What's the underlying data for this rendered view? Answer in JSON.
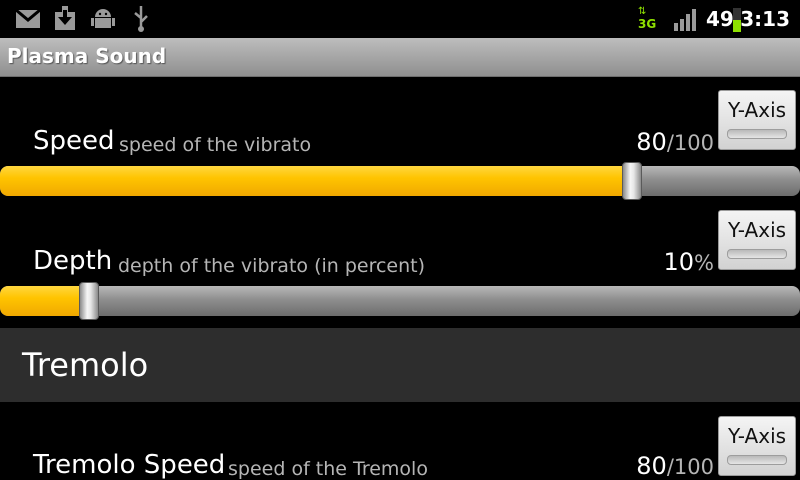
{
  "status_bar": {
    "icons_left": [
      "gmail-icon",
      "download-icon",
      "android-debug-icon",
      "usb-icon"
    ],
    "network": "3G",
    "battery": "49",
    "time": "3:13",
    "battery_color": "#8ee000",
    "network_color": "#8ee000"
  },
  "title_bar": {
    "title": "Plasma Sound"
  },
  "rows": [
    {
      "label": "Speed",
      "description": "speed of the vibrato",
      "value": "80",
      "suffix": "/100",
      "fraction": 0.8,
      "button_label": "Y-Axis"
    },
    {
      "label": "Depth",
      "description": "depth of the vibrato (in percent)",
      "value": "10",
      "suffix": "%",
      "fraction": 0.1,
      "button_label": "Y-Axis"
    }
  ],
  "section": {
    "title": "Tremolo"
  },
  "tremolo_row": {
    "label": "Tremolo Speed",
    "description": "speed of the Tremolo",
    "value": "80",
    "suffix": "/100",
    "button_label": "Y-Axis"
  },
  "colors": {
    "accent": "#ffc400",
    "track": "#8e8e8e"
  }
}
